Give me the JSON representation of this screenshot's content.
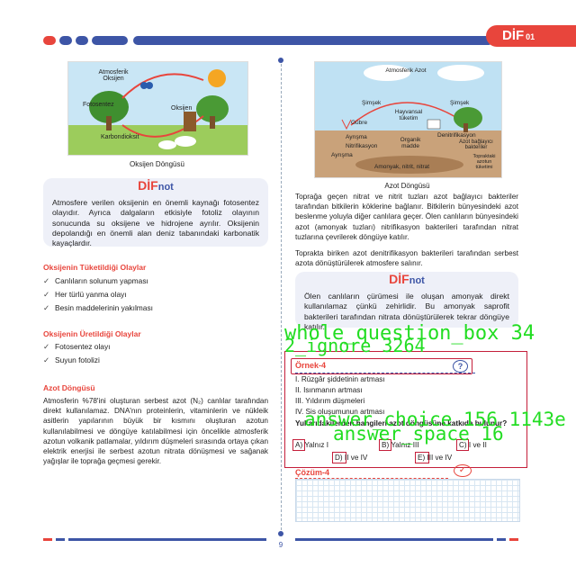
{
  "header": {
    "badge": "DİF",
    "badge_num": "01",
    "colors": {
      "red": "#e8453c",
      "blue": "#3d55a6"
    }
  },
  "left": {
    "figure_caption": "Oksijen Döngüsü",
    "fig_labels": {
      "atmosfer": "Atmosferik Oksijen",
      "foto": "Fotosentez",
      "oksijen": "Oksijen",
      "karbon": "Karbondioksit"
    },
    "note_logo_a": "DİF",
    "note_logo_b": "not",
    "note_text": "Atmosfere verilen oksijenin en önemli kaynağı fotosentez olayıdır. Ayrıca dalgaların etkisiyle fotoliz olayının sonucunda su oksijene ve hidrojene ayrılır. Oksijenin depolandığı en önemli alan deniz tabanındaki karbonatik kayaçlardır.",
    "consume_title": "Oksijenin Tüketildiği Olaylar",
    "consume_items": [
      "Canlıların solunum yapması",
      "Her türlü yanma olayı",
      "Besin maddelerinin yakılması"
    ],
    "produce_title": "Oksijenin Üretildiği Olaylar",
    "produce_items": [
      "Fotosentez olayı",
      "Suyun fotolizi"
    ],
    "azot_title": "Azot Döngüsü",
    "azot_text": "Atmosferin %78'ini oluşturan serbest azot (N₂) canlılar tarafından direkt kullanılamaz. DNA'nın proteinlerin, vitaminlerin ve nükleik asitlerin yapılarının büyük bir kısmını oluşturan azotun kullanılabilmesi ve döngüye katılabilmesi için öncelikle atmosferik azotun volkanik patlamalar, yıldırım düşmeleri sırasında ortaya çıkan elektrik enerjisi ile serbest azotun nitrata dönüşmesi ve sağanak yağışlar ile toprağa geçmesi gerekir."
  },
  "right": {
    "figure_caption": "Azot Döngüsü",
    "fig_labels": {
      "atm": "Atmosferik Azot",
      "simsek1": "Şimşek",
      "simsek2": "Şimşek",
      "hayvansal": "Hayvansal tüketim",
      "gubre": "Gübre",
      "denitri": "Denitrifikasyon",
      "ayrisma1": "Ayrışma",
      "nitri": "Nitrifikasyon",
      "organik": "Organik madde",
      "azotbag": "Azot bağlayıcı bakteriler",
      "ayrisma2": "Ayrışma",
      "amonyak": "Amonyak, nitrit, nitrat",
      "topraktaki": "Topraktaki azotun tüketimi"
    },
    "para1": "Toprağa geçen nitrat ve nitrit tuzları azot bağlayıcı bakteriler tarafından bitkilerin köklerine bağlanır. Bitkilerin bünyesindeki azot beslenme yoluyla diğer canlılara geçer. Ölen canlıların bünyesindeki azot (amonyak tuzları) nitrifikasyon bakterileri tarafından nitrat tuzlarına çevrilerek döngüye katılır.",
    "para2": "Toprakta biriken azot denitrifikasyon bakterileri tarafından serbest azota dönüştürülerek atmosfere salınır.",
    "note_logo_a": "DİF",
    "note_logo_b": "not",
    "note_text": "Ölen canlıların çürümesi ile oluşan amonyak direkt kullanılamaz çünkü zehirlidir. Bu amonyak saprofit bakterileri tarafından nitrata dönüştürülerek tekrar döngüye katılır.",
    "example_label": "Örnek-4",
    "example_items": [
      "I.   Rüzgâr şiddetinin artması",
      "II.  Isınmanın artması",
      "III. Yıldırım düşmeleri",
      "IV. Sis oluşumunun artması"
    ],
    "question": "Yukarıdakilerden hangileri azot döngüsüne katkıda bulunur?",
    "answers": [
      "A) Yalnız I",
      "B) Yalnız III",
      "C) I ve II",
      "D) II ve IV",
      "E) III ve IV"
    ],
    "solution_label": "Çözüm-4"
  },
  "annotations": {
    "whole": "whole_question_box 34",
    "ignore": "2_ignore 3264",
    "answer": "answer_choice 156 1143e",
    "ansspace": "answer_space 16"
  },
  "footer": {
    "page": "9"
  }
}
